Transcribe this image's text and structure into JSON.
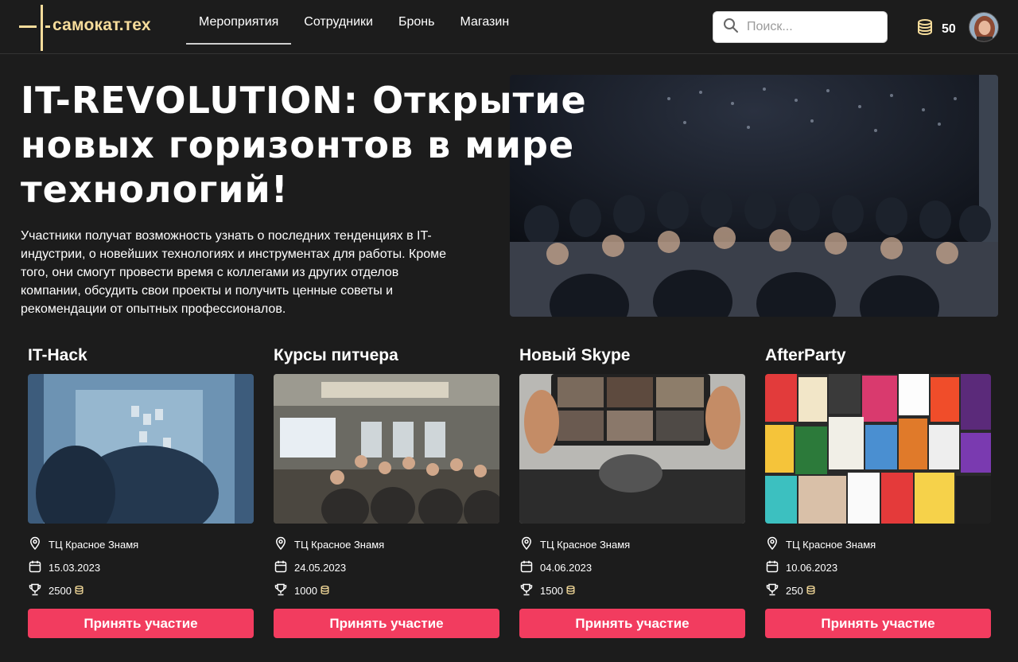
{
  "brand": {
    "name": "самокат.тех"
  },
  "nav": {
    "items": [
      {
        "label": "Мероприятия",
        "active": true
      },
      {
        "label": "Сотрудники",
        "active": false
      },
      {
        "label": "Бронь",
        "active": false
      },
      {
        "label": "Магазин",
        "active": false
      }
    ]
  },
  "search": {
    "placeholder": "Поиск...",
    "value": ""
  },
  "wallet": {
    "balance": "50",
    "icon": "coins-icon"
  },
  "colors": {
    "accent": "#f23c5f",
    "brand": "#f6dc9b",
    "background": "#1c1c1c"
  },
  "hero": {
    "title_line1": "IT-REVOLUTION: Открытие",
    "title_line2": "новых горизонтов в мире",
    "title_line3": "технологий!",
    "description": "Участники получат возможность узнать о последних тенденциях в IT-индустрии, о новейших технологиях и инструментах для работы. Кроме того, они смогут провести время с коллегами из других отделов компании, обсудить свои проекты и получить ценные советы и рекомендации от опытных профессионалов."
  },
  "events": [
    {
      "title": "IT-Hack",
      "location": "ТЦ Красное Знамя",
      "date": "15.03.2023",
      "prize": "2500",
      "button": "Принять участие"
    },
    {
      "title": "Курсы питчера",
      "location": "ТЦ Красное Знамя",
      "date": "24.05.2023",
      "prize": "1000",
      "button": "Принять участие"
    },
    {
      "title": "Новый Skype",
      "location": "ТЦ Красное Знамя",
      "date": "04.06.2023",
      "prize": "1500",
      "button": "Принять участие"
    },
    {
      "title": "AfterParty",
      "location": "ТЦ Красное Знамя",
      "date": "10.06.2023",
      "prize": "250",
      "button": "Принять участие"
    }
  ]
}
